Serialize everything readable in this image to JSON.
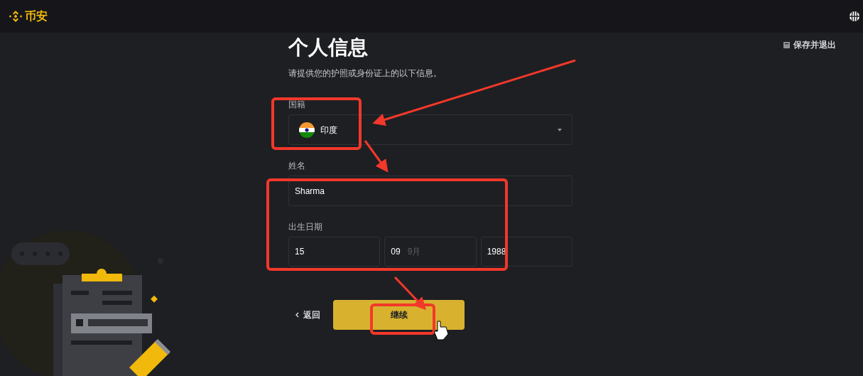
{
  "header": {
    "logo_text": "币安"
  },
  "save_exit": "保存并退出",
  "form": {
    "title": "个人信息",
    "subtitle": "请提供您的护照或身份证上的以下信息。",
    "nationality": {
      "label": "国籍",
      "value": "印度"
    },
    "name": {
      "label": "姓名",
      "value": "Sharma"
    },
    "birth_date": {
      "label": "出生日期",
      "fields": [
        {
          "value": "15"
        },
        {
          "value": "09",
          "hint": "9月"
        },
        {
          "value": "1988"
        }
      ]
    },
    "back": "返回",
    "continue": "继续"
  }
}
